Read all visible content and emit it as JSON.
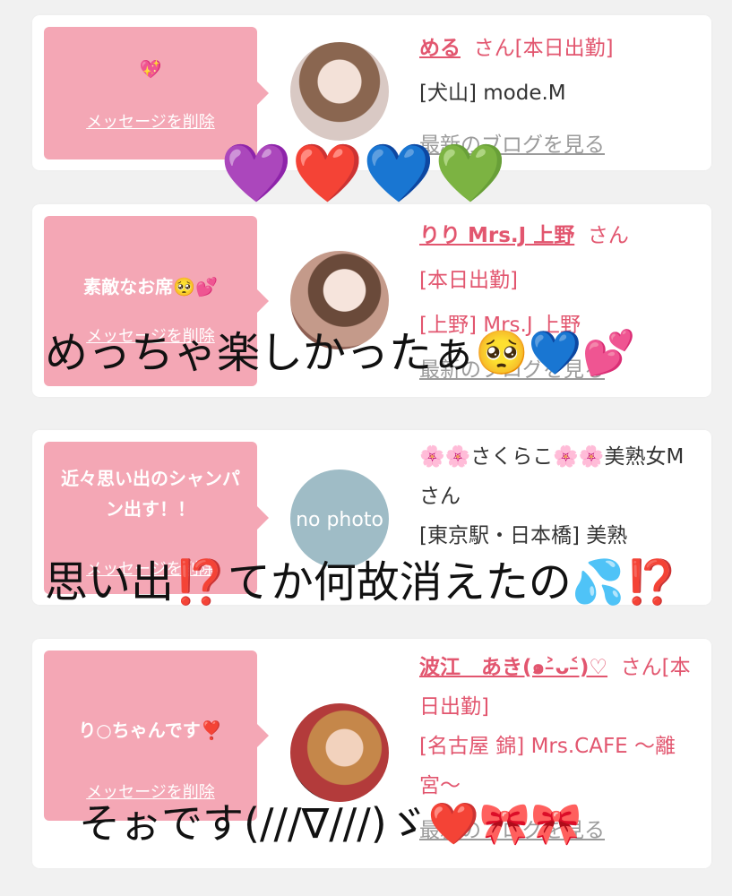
{
  "delete_label": "メッセージを削除",
  "blog_label": "最新のブログを見る",
  "cards": [
    {
      "message": "💖",
      "name": "める",
      "san": "さん[本日出勤]",
      "shop": "[犬山] mode.M"
    },
    {
      "message": "素敵なお席🥺💕",
      "name": "りり Mrs.J 上野",
      "san": "さん",
      "status": "[本日出勤]",
      "shop": "[上野] Mrs.J 上野"
    },
    {
      "message": "近々思い出のシャンパン出す！！",
      "name": "🌸🌸さくらこ🌸🌸美熟女Mさん",
      "shop": "[東京駅・日本橋] 美熟",
      "avatar_text": "no photo"
    },
    {
      "message": "り○ちゃんです❣️",
      "name": "波江　あき(๑˃̵ᴗ˂̵)♡",
      "san": "さん[本日出勤]",
      "shop": "[名古屋 錦] Mrs.CAFE 〜離宮〜"
    }
  ],
  "overlays": {
    "hearts": "💜❤️💙💚",
    "line1": "めっちゃ楽しかったぁ🥺💙💕",
    "line2": "思い出⁉️てか何故消えたの💦⁉️",
    "line3": "そぉです(///∇///)ゞ❤️🎀🎀"
  },
  "colors": {
    "accent": "#e2566f",
    "bubble": "#f4a7b5",
    "link_gray": "#9b9b9b",
    "background": "#f1f1f1"
  }
}
